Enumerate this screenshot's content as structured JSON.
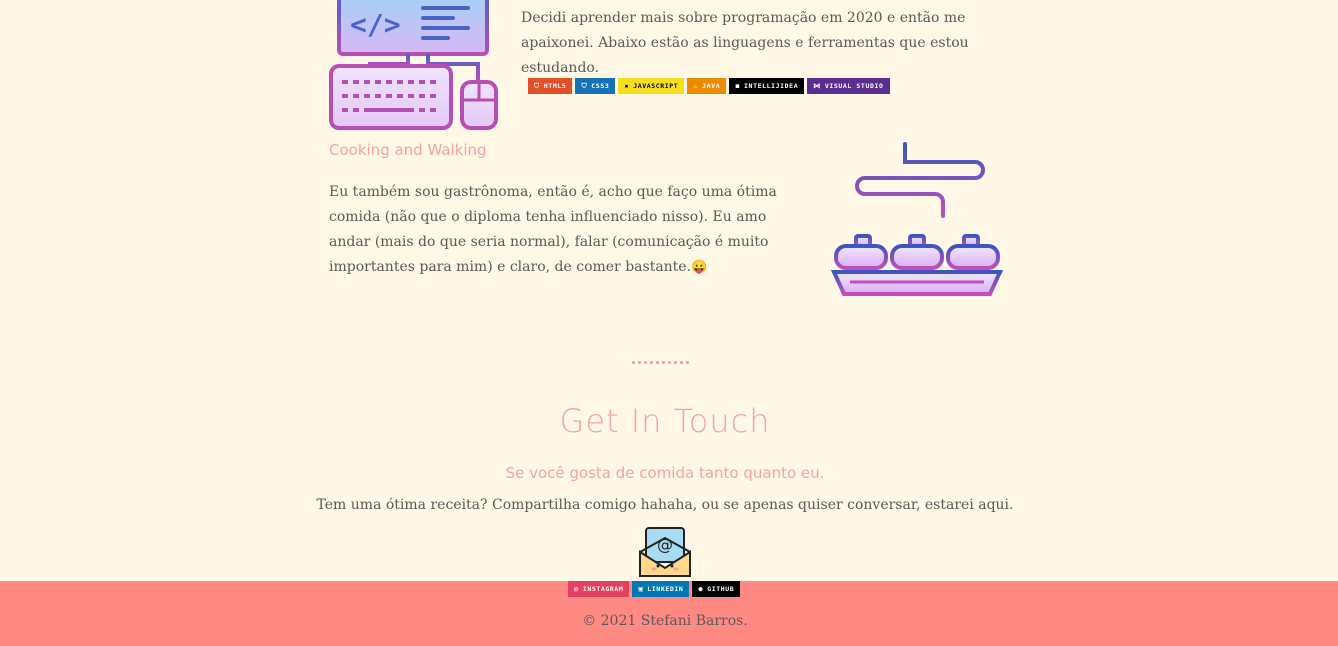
{
  "programming": {
    "paragraph": "Decidi aprender mais sobre programação em 2020 e então me apaixonei. Abaixo estão as linguagens e ferramentas que estou estudando.",
    "badges": [
      {
        "label": "HTML5",
        "color": "#e34f26",
        "icon": "html5-icon"
      },
      {
        "label": "CSS3",
        "color": "#1572b6",
        "icon": "css3-icon"
      },
      {
        "label": "JAVASCRIPT",
        "color": "#f7df1e",
        "text_color": "#000000",
        "icon": "javascript-icon"
      },
      {
        "label": "JAVA",
        "color": "#ed8b00",
        "icon": "java-icon"
      },
      {
        "label": "INTELLIJIDEA",
        "color": "#000000",
        "icon": "intellij-icon"
      },
      {
        "label": "VISUAL STUDIO",
        "color": "#5c2d91",
        "icon": "visual-studio-icon"
      }
    ]
  },
  "cooking": {
    "title": "Cooking and Walking",
    "paragraph": "Eu também sou gastrônoma, então é, acho que faço uma ótima comida (não que o diploma tenha influenciado nisso). Eu amo andar (mais do que seria normal), falar (comunicação é muito importantes para mim) e claro, de comer bastante.",
    "emoji": "😛"
  },
  "contact": {
    "title": "Get In Touch",
    "subtitle": "Se você gosta de comida tanto quanto eu.",
    "paragraph": "Tem uma ótima receita? Compartilha comigo hahaha, ou se apenas quiser conversar, estarei aqui."
  },
  "footer": {
    "social_badges": [
      {
        "label": "INSTAGRAM",
        "color": "#e4405f",
        "icon": "instagram-icon"
      },
      {
        "label": "LINKEDIN",
        "color": "#0077b5",
        "icon": "linkedin-icon"
      },
      {
        "label": "GITHUB",
        "color": "#000000",
        "icon": "github-icon"
      }
    ],
    "copyright": "© 2021 Stefani Barros."
  },
  "colors": {
    "background": "#fff8e6",
    "accent_pink": "#f7a3a0",
    "footer_bg": "#ff8a84"
  }
}
